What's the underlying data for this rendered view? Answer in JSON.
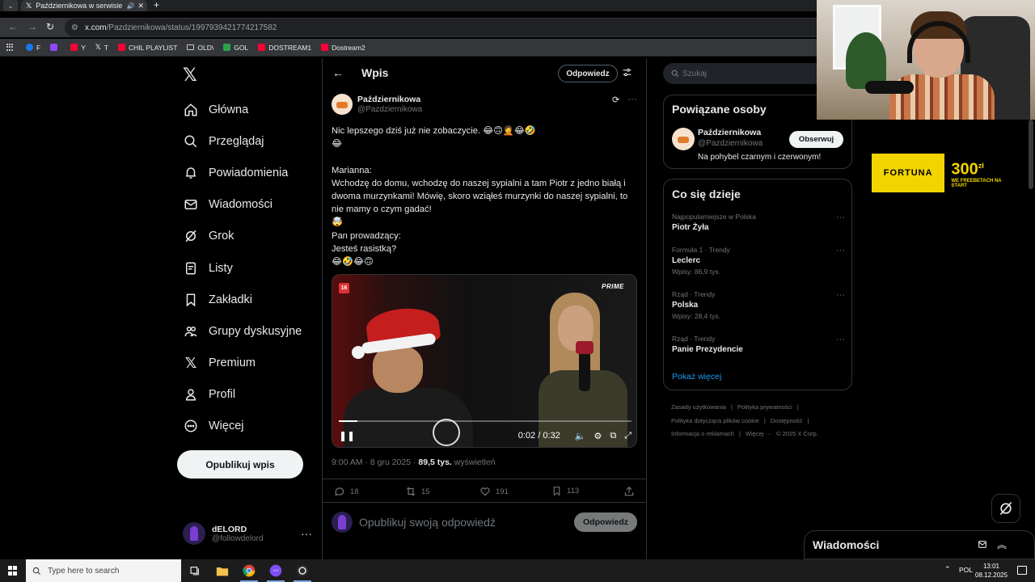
{
  "browser": {
    "tab_title": "Październikowa w serwisie X",
    "url_host": "x.com",
    "url_path": "/Pazdziernikowa/status/1997939421774217582",
    "bookmarks": [
      {
        "label": "F",
        "color": "#1877f2"
      },
      {
        "label": "",
        "color": "#9146ff"
      },
      {
        "label": "Y",
        "color": "#ff0033"
      },
      {
        "label": "T",
        "color": "#ffffff"
      },
      {
        "label": "CHIL PLAYLIST",
        "color": "#ff0033"
      },
      {
        "label": "OLD\\",
        "color": "folder"
      },
      {
        "label": "GOL",
        "color": "#2aa34a"
      },
      {
        "label": "DOSTREAM1",
        "color": "#ff0033"
      },
      {
        "label": "Dostream2",
        "color": "#ff0033"
      }
    ]
  },
  "sidebar": {
    "items": [
      {
        "label": "Główna",
        "icon": "home-icon"
      },
      {
        "label": "Przeglądaj",
        "icon": "search-icon"
      },
      {
        "label": "Powiadomienia",
        "icon": "bell-icon"
      },
      {
        "label": "Wiadomości",
        "icon": "mail-icon"
      },
      {
        "label": "Grok",
        "icon": "grok-icon"
      },
      {
        "label": "Listy",
        "icon": "list-icon"
      },
      {
        "label": "Zakładki",
        "icon": "bookmark-icon"
      },
      {
        "label": "Grupy dyskusyjne",
        "icon": "people-icon"
      },
      {
        "label": "Premium",
        "icon": "x-icon"
      },
      {
        "label": "Profil",
        "icon": "person-icon"
      },
      {
        "label": "Więcej",
        "icon": "more-circle-icon"
      }
    ],
    "post_button": "Opublikuj wpis",
    "user": {
      "name": "dELORD",
      "handle": "@followdelord"
    }
  },
  "main": {
    "title": "Wpis",
    "reply_pill": "Odpowiedz",
    "author": {
      "name": "Październikowa",
      "handle": "@Pazdziernikowa"
    },
    "text": "Nic lepszego dziś już nie zobaczycie. 😂🙃🤦😂🤣\n😂\n\nMarianna:\nWchodzę do domu, wchodzę do naszej sypialni a tam Piotr z jedno białą i dwoma murzynkami! Mówię, skoro wziąłeś murzynki do naszej sypialni, to nie mamy o czym gadać!\n🤯\nPan prowadzący:\nJesteś rasistką?\n😂🤣😂🙃",
    "video": {
      "age_badge": "16",
      "brand": "PRIME",
      "time": "0:02 / 0:32",
      "progress": 0.0625
    },
    "meta": {
      "time": "9:00 AM · 8 gru 2025 · ",
      "views": "89,5 tys.",
      "views_label": " wyświetleń"
    },
    "actions": {
      "replies": "18",
      "reposts": "15",
      "likes": "191",
      "bookmarks": "113"
    },
    "reply_placeholder": "Opublikuj swoją odpowiedź",
    "reply_button": "Odpowiedz"
  },
  "right": {
    "search_placeholder": "Szukaj",
    "related": {
      "title": "Powiązane osoby",
      "name": "Październikowa",
      "handle": "@Pazdziernikowa",
      "bio": "Na pohybel czarnym i czerwonym!",
      "follow": "Obserwuj"
    },
    "trends": {
      "title": "Co się dzieje",
      "items": [
        {
          "category": "Najpopularniejsze w Polska",
          "topic": "Piotr Żyła",
          "posts": ""
        },
        {
          "category": "Formuła 1 · Trendy",
          "topic": "Leclerc",
          "posts": "Wpisy: 86,9 tys."
        },
        {
          "category": "Rząd · Trendy",
          "topic": "Polska",
          "posts": "Wpisy: 28,4 tys."
        },
        {
          "category": "Rząd · Trendy",
          "topic": "Panie Prezydencie",
          "posts": ""
        }
      ],
      "show_more": "Pokaż więcej"
    },
    "footer": [
      "Zasady użytkowania",
      "|",
      "Polityka prywatności",
      "|",
      "Polityka dotycząca plików cookie",
      "|",
      "Dostępność",
      "|",
      "Informacja o reklamach",
      "|",
      "Więcej ···",
      "© 2025 X Corp."
    ],
    "ad": {
      "brand": "FORTUNA",
      "amount": "300",
      "currency": "zł",
      "tagline": "WE FREEBETACH NA START"
    },
    "messages": "Wiadomości"
  },
  "taskbar": {
    "search_placeholder": "Type here to search",
    "lang": "POL",
    "time": "13:01",
    "date": "08.12.2025"
  },
  "colors": {
    "accent": "#1d9bf0",
    "background": "#000000",
    "border": "#2f3336",
    "muted": "#71767b"
  }
}
